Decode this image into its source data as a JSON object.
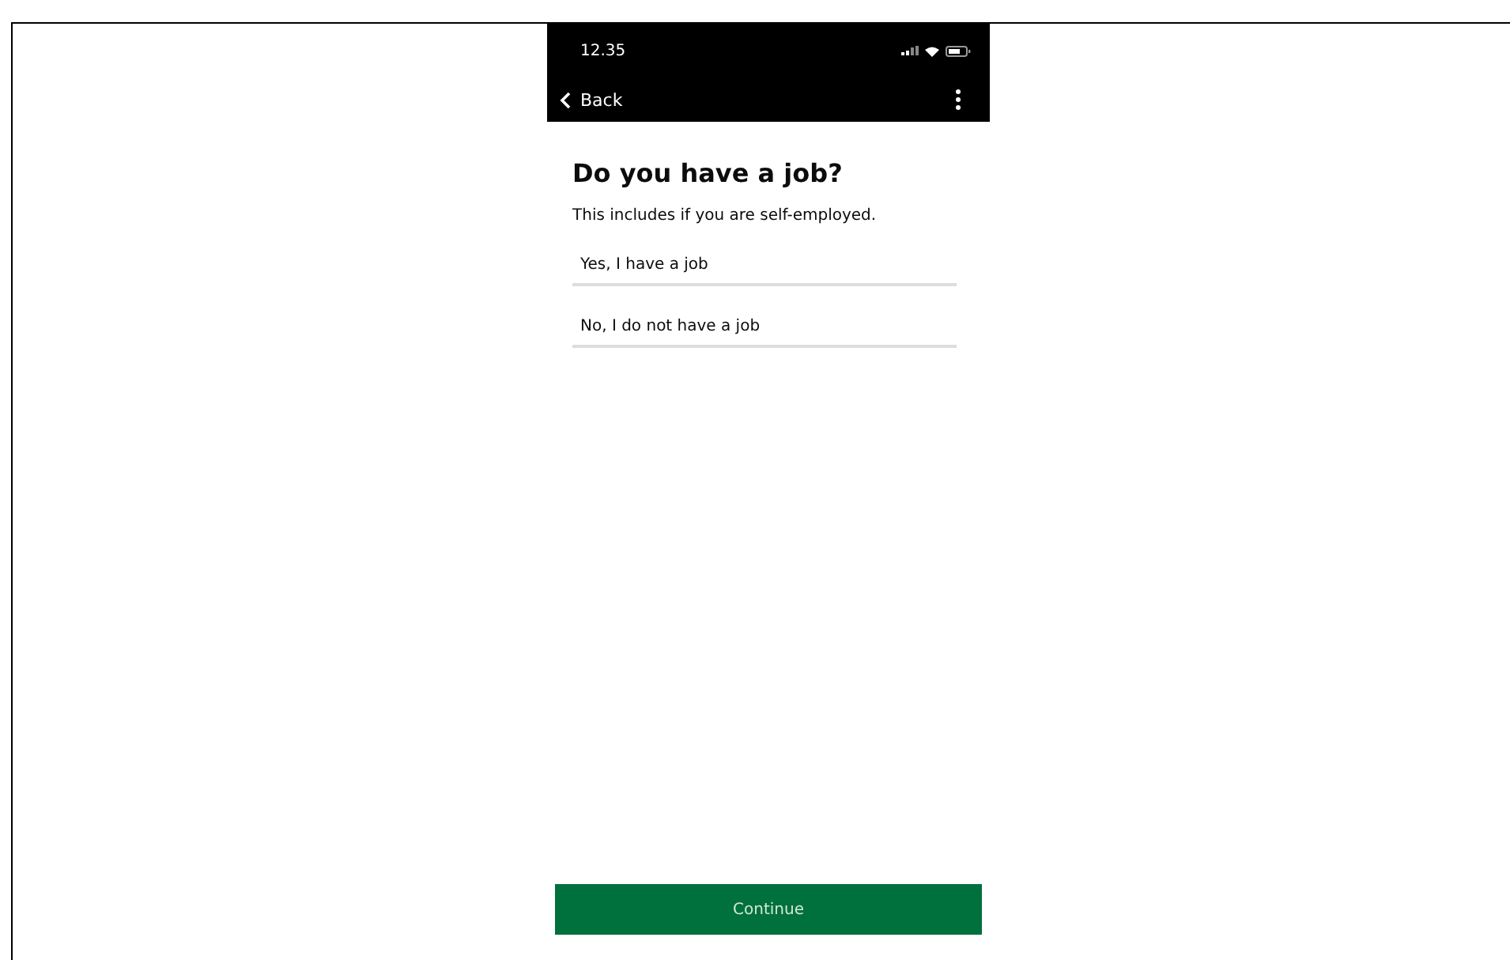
{
  "status_bar": {
    "time": "12.35"
  },
  "nav_bar": {
    "back_label": "Back"
  },
  "question": {
    "title": "Do you have a job?",
    "hint": "This includes if you are self-employed."
  },
  "options": [
    {
      "label": "Yes, I have a job"
    },
    {
      "label": "No, I do not have a job"
    }
  ],
  "continue_button": {
    "label": "Continue"
  }
}
